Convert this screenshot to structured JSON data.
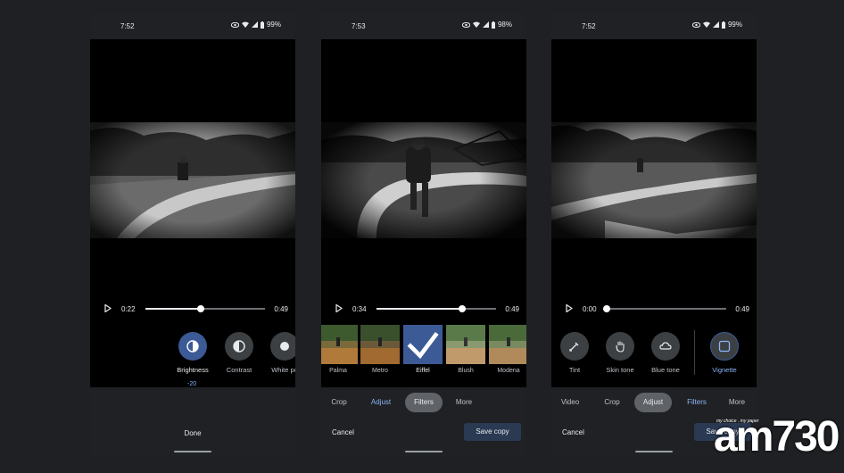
{
  "phones": [
    {
      "status": {
        "time": "7:52",
        "battery": "99%"
      },
      "video": {
        "current": "0:22",
        "end": "0:49",
        "progress": 0.46
      },
      "tools": [
        {
          "label": "Brightness",
          "icon": "brightness-icon",
          "active": true
        },
        {
          "label": "Contrast",
          "icon": "contrast-icon",
          "active": false
        },
        {
          "label": "White po",
          "icon": "white-point-icon",
          "active": false
        }
      ],
      "slider_value": "-20",
      "done_label": "Done"
    },
    {
      "status": {
        "time": "7:53",
        "battery": "98%"
      },
      "video": {
        "current": "0:34",
        "end": "0:49",
        "progress": 0.72
      },
      "filters": [
        {
          "label": "Palma",
          "selected": false
        },
        {
          "label": "Metro",
          "selected": false
        },
        {
          "label": "Eiffel",
          "selected": true
        },
        {
          "label": "Blush",
          "selected": false
        },
        {
          "label": "Modena",
          "selected": false
        }
      ],
      "tabs": [
        "Crop",
        "Adjust",
        "Filters",
        "More"
      ],
      "active_tab": "Filters",
      "cancel_label": "Cancel",
      "save_label": "Save copy"
    },
    {
      "status": {
        "time": "7:52",
        "battery": "99%"
      },
      "video": {
        "current": "0:00",
        "end": "0:49",
        "progress": 0.0
      },
      "tools": [
        {
          "label": "Tint",
          "icon": "dropper-icon"
        },
        {
          "label": "Skin tone",
          "icon": "hand-icon"
        },
        {
          "label": "Blue tone",
          "icon": "cloud-icon"
        },
        {
          "label": "Vignette",
          "icon": "vignette-icon"
        }
      ],
      "tabs": [
        "Video",
        "Crop",
        "Adjust",
        "Filters",
        "More"
      ],
      "active_tab": "Adjust",
      "cancel_label": "Cancel",
      "save_label": "Save copy"
    }
  ],
  "watermark": {
    "tagline": "my choice . my paper",
    "logo": "am730"
  },
  "colors": {
    "accent": "#3c5a95",
    "accent_text": "#8ab4f8",
    "panel": "#202124"
  }
}
